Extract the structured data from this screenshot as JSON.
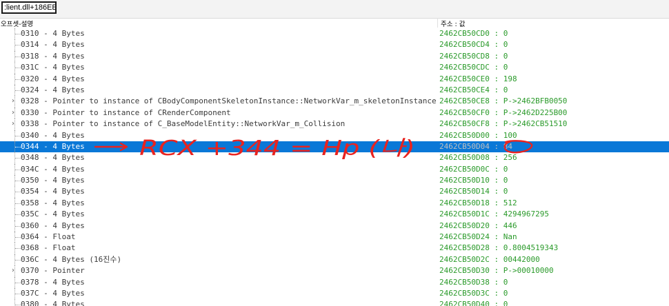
{
  "toolbar": {
    "address_value": ":lient.dll+186EE00"
  },
  "columns": {
    "offset_description": "오프셋-설명",
    "address_value": "주소 : 값"
  },
  "rows": [
    {
      "desc": "0310 - 4 Bytes",
      "val": "2462CB50CD0 : 0",
      "expand": false
    },
    {
      "desc": "0314 - 4 Bytes",
      "val": "2462CB50CD4 : 0",
      "expand": false
    },
    {
      "desc": "0318 - 4 Bytes",
      "val": "2462CB50CD8 : 0",
      "expand": false
    },
    {
      "desc": "031C - 4 Bytes",
      "val": "2462CB50CDC : 0",
      "expand": false
    },
    {
      "desc": "0320 - 4 Bytes",
      "val": "2462CB50CE0 : 198",
      "expand": false
    },
    {
      "desc": "0324 - 4 Bytes",
      "val": "2462CB50CE4 : 0",
      "expand": false
    },
    {
      "desc": "0328 - Pointer to instance of CBodyComponentSkeletonInstance::NetworkVar_m_skeletonInstance",
      "val": "2462CB50CE8 : P->2462BFB0050",
      "expand": true
    },
    {
      "desc": "0330 - Pointer to instance of CRenderComponent",
      "val": "2462CB50CF0 : P->2462D225B00",
      "expand": true
    },
    {
      "desc": "0338 - Pointer to instance of C_BaseModelEntity::NetworkVar_m_Collision",
      "val": "2462CB50CF8 : P->2462CB51510",
      "expand": true
    },
    {
      "desc": "0340 - 4 Bytes",
      "val": "2462CB50D00 : 100",
      "expand": false
    },
    {
      "desc": "0344 - 4 Bytes",
      "val": "2462CB50D04 : 84",
      "expand": false,
      "selected": true
    },
    {
      "desc": "0348 - 4 Bytes",
      "val": "2462CB50D08 : 256",
      "expand": false
    },
    {
      "desc": "034C - 4 Bytes",
      "val": "2462CB50D0C : 0",
      "expand": false
    },
    {
      "desc": "0350 - 4 Bytes",
      "val": "2462CB50D10 : 0",
      "expand": false
    },
    {
      "desc": "0354 - 4 Bytes",
      "val": "2462CB50D14 : 0",
      "expand": false
    },
    {
      "desc": "0358 - 4 Bytes",
      "val": "2462CB50D18 : 512",
      "expand": false
    },
    {
      "desc": "035C - 4 Bytes",
      "val": "2462CB50D1C : 4294967295",
      "expand": false
    },
    {
      "desc": "0360 - 4 Bytes",
      "val": "2462CB50D20 : 446",
      "expand": false
    },
    {
      "desc": "0364 - Float",
      "val": "2462CB50D24 : Nan",
      "expand": false
    },
    {
      "desc": "0368 - Float",
      "val": "2462CB50D28 : 0.8004519343",
      "expand": false
    },
    {
      "desc": "036C - 4 Bytes (16진수)",
      "val": "2462CB50D2C : 00442000",
      "expand": false
    },
    {
      "desc": "0370 - Pointer",
      "val": "2462CB50D30 : P->00010000",
      "expand": true
    },
    {
      "desc": "0378 - 4 Bytes",
      "val": "2462CB50D38 : 0",
      "expand": false
    },
    {
      "desc": "037C - 4 Bytes",
      "val": "2462CB50D3C : 0",
      "expand": false
    },
    {
      "desc": "0380 - 4 Bytes",
      "val": "2462CB50D40 : 0",
      "expand": false
    }
  ],
  "annotation": {
    "text": "RCX +344 = Hp (나)",
    "color": "#e8231f"
  },
  "colors": {
    "selection": "#0a78d7",
    "value_text": "#2a9a2a",
    "annotation": "#e8231f"
  }
}
